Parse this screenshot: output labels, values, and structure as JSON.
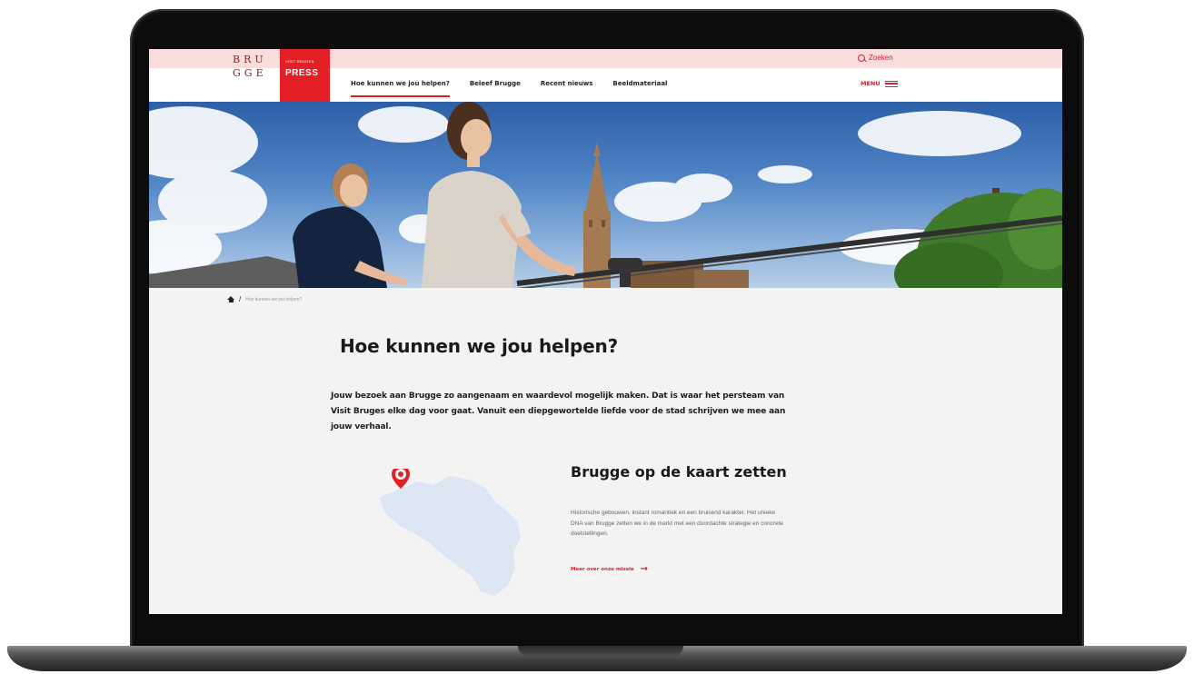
{
  "header": {
    "search_label": "Zoeken",
    "menu_label": "MENU",
    "logo": {
      "line1": "BRU",
      "line2": "GGE",
      "badge_small": "VISIT BRUGES",
      "badge_big": "PRESS"
    },
    "nav": [
      {
        "label": "Hoe kunnen we jou helpen?",
        "active": true
      },
      {
        "label": "Beleef Brugge",
        "active": false
      },
      {
        "label": "Recent nieuws",
        "active": false
      },
      {
        "label": "Beeldmateriaal",
        "active": false
      }
    ]
  },
  "breadcrumb": {
    "current": "Hoe kunnen we jou helpen?"
  },
  "main": {
    "title": "Hoe kunnen we jou helpen?",
    "intro": "Jouw bezoek aan Brugge zo aangenaam en waardevol mogelijk maken. Dat is waar het persteam van Visit Bruges elke dag voor gaat. Vanuit een diepgewortelde liefde voor de stad schrijven we mee aan jouw verhaal.",
    "card": {
      "title": "Brugge op de kaart zetten",
      "text": "Historische gebouwen, instant romantiek en een bruisend karakter. Het unieke DNA van Brugge zetten we in de markt met een doordachte strategie en concrete doelstellingen.",
      "link": "Meer over onze missie"
    }
  },
  "colors": {
    "accent": "#e31e24",
    "topbar": "#f9dcdc",
    "map_fill": "#dde6f3"
  },
  "icons": {
    "search": "search-icon",
    "menu": "hamburger-icon",
    "home": "home-icon",
    "map_pin": "map-pin-icon",
    "arrow": "arrow-right-icon"
  }
}
